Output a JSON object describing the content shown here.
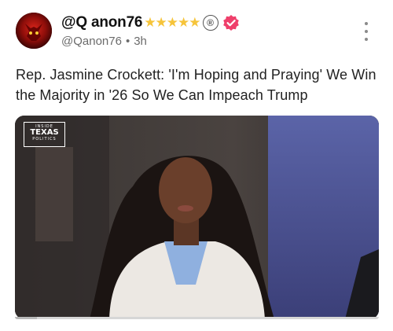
{
  "post": {
    "author": {
      "display_name": "@Q anon76",
      "badges": "★★★★★",
      "registered_mark": "®",
      "handle": "@Qanon76",
      "separator": "•",
      "time_ago": "3h",
      "verified_color": "#ef3f6b"
    },
    "text": "Rep. Jasmine Crockett: 'I'm Hoping and Praying' We Win the Majority in '26 So We Can Impeach Trump",
    "media": {
      "logo_line1": "INSIDE",
      "logo_line2": "TEXAS",
      "logo_line3": "POLITICS",
      "progress": 0.06
    }
  },
  "colors": {
    "star": "#f6c43a",
    "muted_text": "#6b6b6b"
  },
  "icons": {
    "more": "vertical-ellipsis-icon",
    "verified": "verified-badge-icon"
  }
}
